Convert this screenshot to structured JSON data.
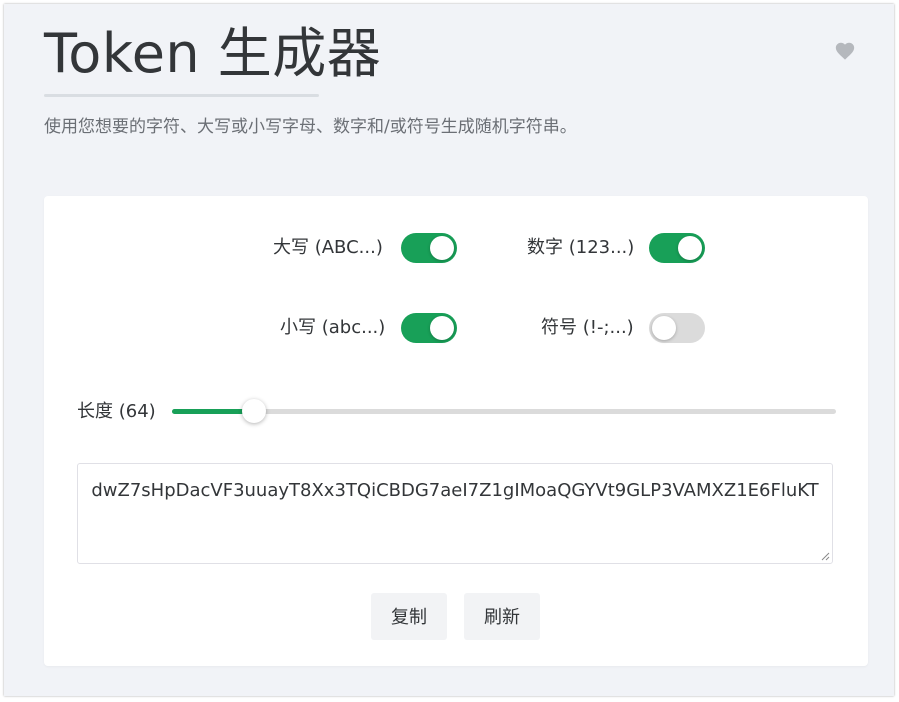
{
  "header": {
    "title": "Token 生成器",
    "subtitle": "使用您想要的字符、大写或小写字母、数字和/或符号生成随机字符串。",
    "favorite_icon": "heart-icon"
  },
  "options": {
    "uppercase": {
      "label": "大写 (ABC...)",
      "enabled": true
    },
    "numbers": {
      "label": "数字 (123...)",
      "enabled": true
    },
    "lowercase": {
      "label": "小写 (abc...)",
      "enabled": true
    },
    "symbols": {
      "label": "符号 (!-;...)",
      "enabled": false
    }
  },
  "length": {
    "label": "长度 (64)",
    "value": 64,
    "min": 1,
    "max": 512
  },
  "output": {
    "token": "dwZ7sHpDacVF3uuayT8Xx3TQiCBDG7aeI7Z1gIMoaQGYVt9GLP3VAMXZ1E6FluKT"
  },
  "actions": {
    "copy_label": "复制",
    "refresh_label": "刷新"
  },
  "colors": {
    "accent": "#18a058",
    "toggle_off": "#dbdbdb",
    "background": "#f1f3f7",
    "heart": "#b5b8bd"
  }
}
